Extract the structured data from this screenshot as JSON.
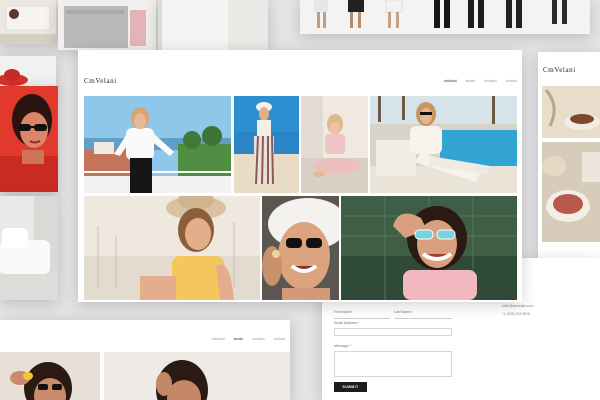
{
  "logo_text": "CmVelani",
  "main_nav": [
    "editorial",
    "studio",
    "location",
    "contact"
  ],
  "second_nav": [
    "editorial",
    "studio",
    "location",
    "contact"
  ],
  "contact_form": {
    "first_name_label": "First Name",
    "last_name_label": "Last Name",
    "email_label": "Email Address *",
    "message_label": "Message *",
    "submit_label": "SUBMIT"
  },
  "contact_info": [
    "Your Address",
    "hello@cmvelani.com",
    "+1 (555) 234-5678"
  ],
  "colors": {
    "accent_red": "#d4332b",
    "dark": "#1d1d1d",
    "pool": "#33a5d4",
    "sky": "#8cc8ea"
  }
}
